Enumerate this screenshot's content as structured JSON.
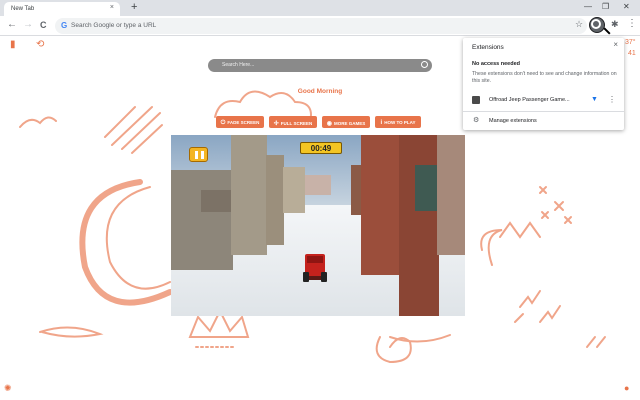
{
  "browser": {
    "tab_title": "New Tab",
    "tab_close": "×",
    "new_tab": "+",
    "window_minimize": "—",
    "window_restore": "❐",
    "window_close": "✕",
    "back": "←",
    "forward": "→",
    "reload": "C",
    "google_g": "G",
    "omnibox_placeholder": "Search Google or type a URL",
    "bookmark_star": "☆",
    "extensions_puzzle": "✱",
    "menu": "⋮"
  },
  "page": {
    "search_placeholder": "Search Here...",
    "greeting": "Good Morning",
    "weather_partial": "37°",
    "weather_line2": "41",
    "buttons": [
      {
        "icon": "⏻",
        "label": "FADE SCREEN"
      },
      {
        "icon": "✢",
        "label": "FULL SCREEN"
      },
      {
        "icon": "◉",
        "label": "MORE GAMES"
      },
      {
        "icon": "i",
        "label": "HOW TO PLAY"
      }
    ],
    "game": {
      "timer": "00:49"
    }
  },
  "extensions_popup": {
    "title": "Extensions",
    "close": "×",
    "heading": "No access needed",
    "description": "These extensions don't need to see and change information on this site.",
    "item_label": "Offroad Jeep Passenger Game...",
    "pin": "📌",
    "more": "⋮",
    "manage_icon": "⚙",
    "manage_label": "Manage extensions"
  },
  "colors": {
    "accent": "#e8744a",
    "timer_yellow": "#f3c524",
    "pin_blue": "#1a73e8"
  }
}
